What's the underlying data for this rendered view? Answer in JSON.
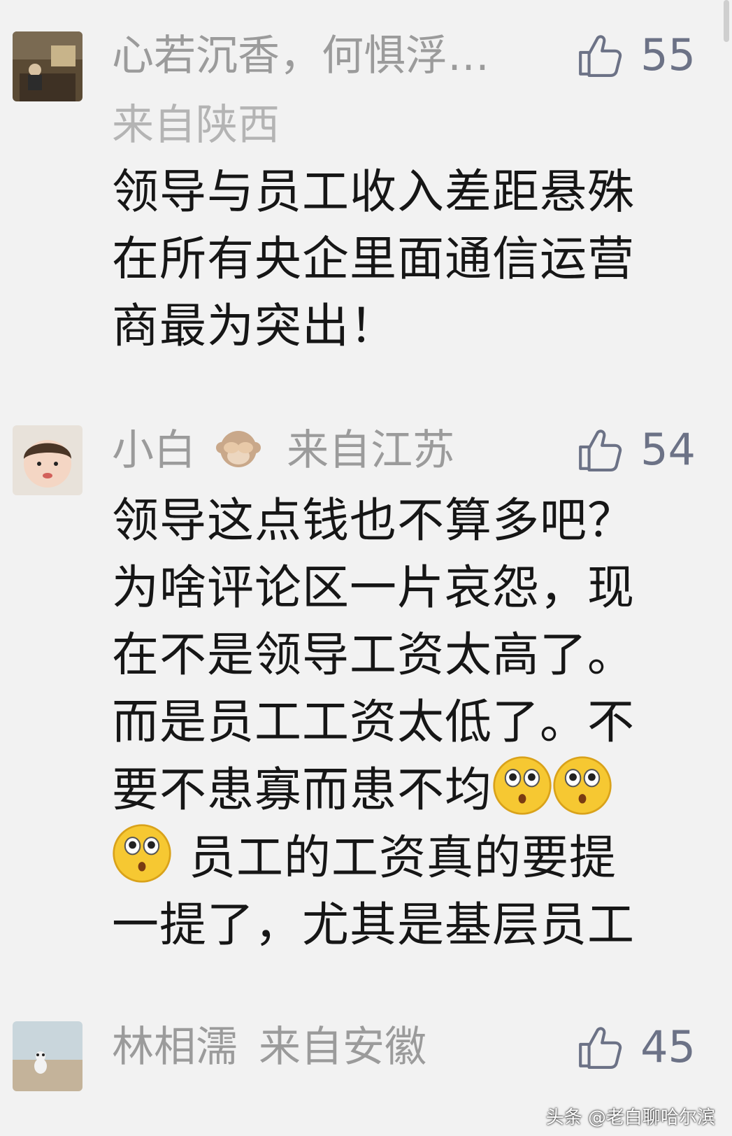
{
  "comments": [
    {
      "username": "心若沉香，何惧浮…",
      "location": "来自陕西",
      "likes": "55",
      "lines": [
        "领导与员工收入差距悬殊",
        "在所有央企里面通信运营",
        "商最为突出！"
      ]
    },
    {
      "username": "小白",
      "location": "来自江苏",
      "likes": "54",
      "lines": [
        "领导这点钱也不算多吧？",
        "为啥评论区一片哀怨，现",
        "在不是领导工资太高了。",
        "而是员工工资太低了。不",
        "要不患寡而患不均",
        "员工的工资真的要提",
        "一提了，尤其是基层员工"
      ]
    },
    {
      "username": "林相濡",
      "location": "来自安徽",
      "likes": "45"
    }
  ],
  "watermark": "头条 @老白聊哈尔滨",
  "icons": {
    "like": "thumbs-up-icon",
    "emoji_monkey": "see-no-evil-monkey-icon",
    "emoji_face": "astonished-face-icon"
  },
  "colors": {
    "background": "#f2f2f2",
    "meta": "#9b9b9b",
    "like": "#6c7286",
    "text": "#161616"
  }
}
